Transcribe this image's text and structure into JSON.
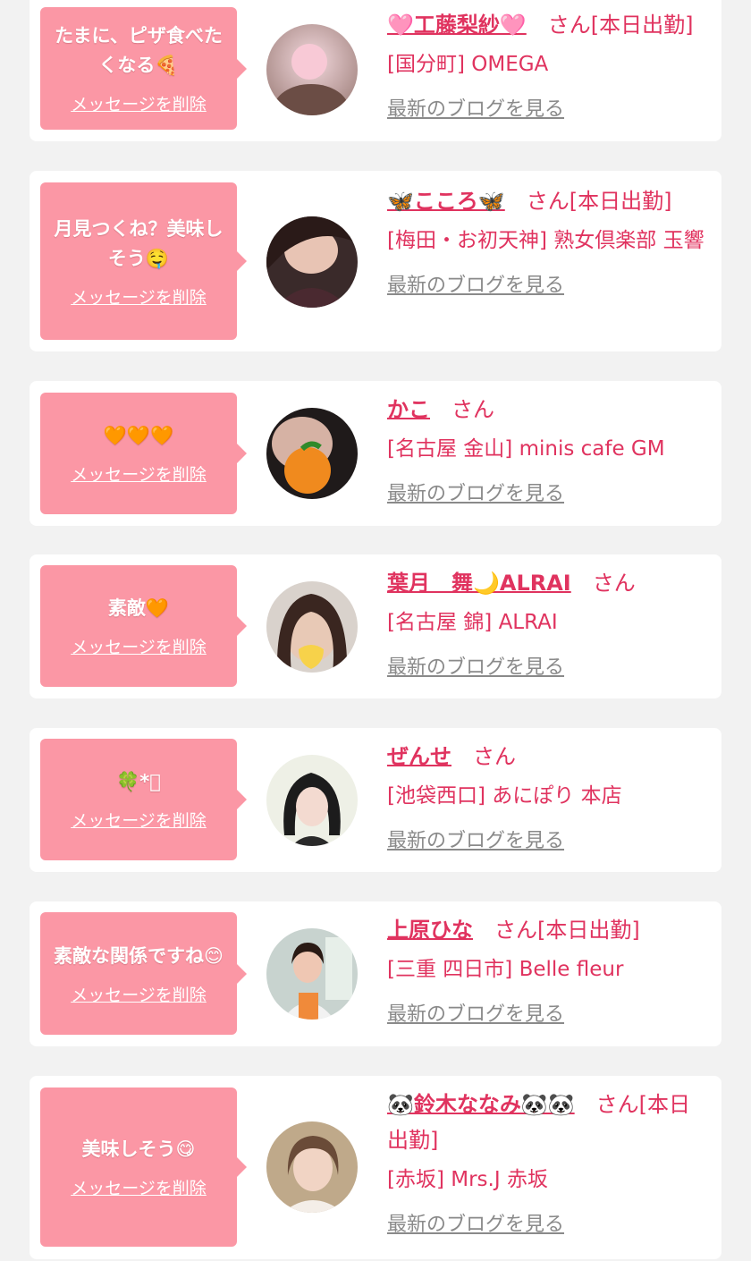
{
  "delete_label": "メッセージを削除",
  "blog_label": "最新のブログを見る",
  "colors": {
    "accent": "#e0335f",
    "bubble": "#fb97a5",
    "link_gray": "#8a8a8a",
    "background": "#f2f2f2"
  },
  "items": [
    {
      "message": "たまに、ピザ食べたくなる🍕",
      "name": "🩷工藤梨紗🩷",
      "suffix": "さん[本日出勤]",
      "shop": "[国分町] OMEGA"
    },
    {
      "message": "月見つくね？美味しそう🤤",
      "name": "🦋こころ🦋",
      "suffix": "さん[本日出勤]",
      "shop": "[梅田・お初天神] 熟女倶楽部 玉響"
    },
    {
      "message": "🧡🧡🧡",
      "name": "かこ",
      "suffix": "さん",
      "shop": "[名古屋 金山] minis cafe GM"
    },
    {
      "message": "素敵🧡",
      "name": "葉月　舞🌙ALRAI",
      "suffix": "さん",
      "shop": "[名古屋 錦] ALRAI"
    },
    {
      "message": "🍀*ﾟ",
      "name": "ぜんせ",
      "suffix": "さん",
      "shop": "[池袋西口] あにぽり 本店"
    },
    {
      "message": "素敵な関係ですね😊",
      "name": "上原ひな",
      "suffix": "さん[本日出勤]",
      "shop": "[三重 四日市] Belle fleur"
    },
    {
      "message": "美味しそう😋",
      "name": "🐼鈴木ななみ🐼🐼",
      "suffix": "さん[本日出勤]",
      "shop": "[赤坂] Mrs.J 赤坂"
    }
  ]
}
